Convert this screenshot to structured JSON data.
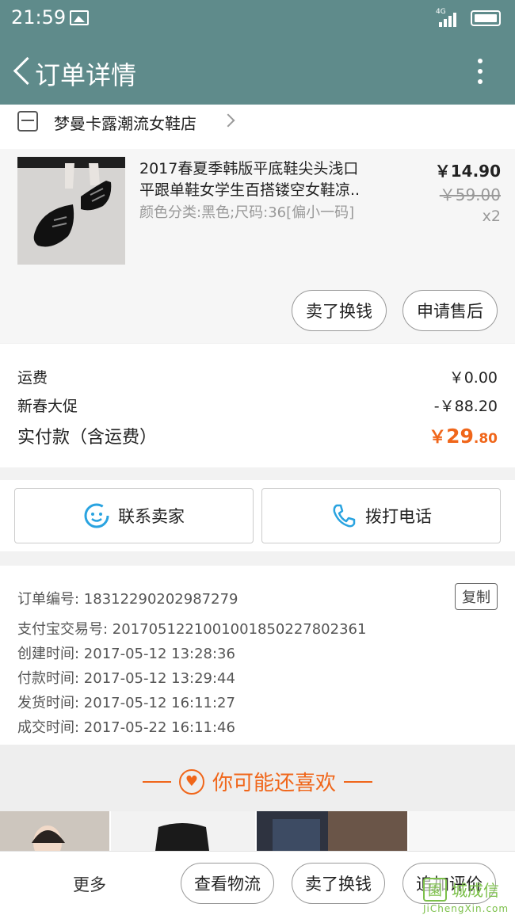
{
  "status_bar": {
    "time": "21:59",
    "network": "4G"
  },
  "header": {
    "title": "订单详情"
  },
  "shop": {
    "name": "梦曼卡露潮流女鞋店"
  },
  "product": {
    "name_line1": "2017春夏季韩版平底鞋尖头浅口",
    "name_line2": "平跟单鞋女学生百搭镂空女鞋凉..",
    "sku": "颜色分类:黑色;尺码:36[偏小一码]",
    "price": "￥14.90",
    "original_price": "￥59.00",
    "quantity": "x2",
    "sell_button": "卖了换钱",
    "after_sale_button": "申请售后"
  },
  "fees": {
    "shipping_label": "运费",
    "shipping_value": "￥0.00",
    "promo_label": "新春大促",
    "promo_value": "-￥88.20",
    "total_label": "实付款（含运费）",
    "total_currency": "￥",
    "total_int": "29",
    "total_dec": ".80"
  },
  "contact": {
    "seller_label": "联系卖家",
    "phone_label": "拨打电话"
  },
  "order_info": {
    "order_no": "订单编号: 18312290202987279",
    "copy_label": "复制",
    "alipay_no": "支付宝交易号: 2017051221001001850227802361",
    "created": "创建时间: 2017-05-12 13:28:36",
    "paid": "付款时间: 2017-05-12 13:29:44",
    "shipped": "发货时间: 2017-05-12 16:11:27",
    "completed": "成交时间: 2017-05-22 16:11:46"
  },
  "recommend": {
    "title": "你可能还喜欢"
  },
  "bottom_bar": {
    "more": "更多",
    "logistics": "查看物流",
    "sell": "卖了换钱",
    "review": "追加评价"
  },
  "watermark": {
    "brand": "城成信",
    "url": "JiChengXin.com"
  },
  "colors": {
    "header_bg": "#5f8b8b",
    "accent_orange": "#f0661a",
    "contact_blue": "#29a3e0"
  }
}
